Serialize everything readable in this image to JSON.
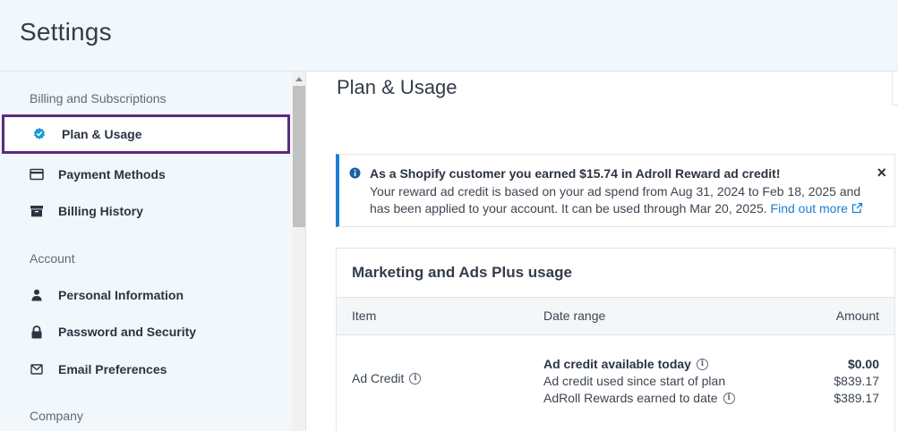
{
  "app": {
    "title": "Settings"
  },
  "sidebar": {
    "sections": [
      {
        "label": "Billing and Subscriptions"
      },
      {
        "label": "Account"
      },
      {
        "label": "Company"
      }
    ],
    "items": [
      {
        "label": "Plan & Usage",
        "icon": "verified-badge-icon"
      },
      {
        "label": "Payment Methods",
        "icon": "credit-card-icon"
      },
      {
        "label": "Billing History",
        "icon": "archive-box-icon"
      },
      {
        "label": "Personal Information",
        "icon": "person-icon"
      },
      {
        "label": "Password and Security",
        "icon": "lock-icon"
      },
      {
        "label": "Email Preferences",
        "icon": "envelope-icon"
      }
    ]
  },
  "main": {
    "title": "Plan & Usage",
    "alert": {
      "title": "As a Shopify customer you earned $15.74 in Adroll Reward ad credit!",
      "line1": "Your reward ad credit is based on your ad spend from Aug 31, 2024 to Feb 18, 2025 and",
      "line2": "has been applied to your account. It can be used through Mar 20, 2025.",
      "link": "Find out more",
      "close": "×"
    },
    "usage": {
      "title": "Marketing and Ads Plus usage",
      "columns": [
        "Item",
        "Date range",
        "Amount"
      ],
      "row": {
        "item": "Ad Credit",
        "lines": [
          {
            "label": "Ad credit available today",
            "amount": "$0.00"
          },
          {
            "label": "Ad credit used since start of plan",
            "amount": "$839.17"
          },
          {
            "label": "AdRoll Rewards earned to date",
            "amount": "$389.17"
          }
        ]
      }
    }
  },
  "colors": {
    "accent": "#1a7ed4",
    "active_border": "#5b2a7e",
    "sidebar_bg": "#f1f7fb"
  }
}
